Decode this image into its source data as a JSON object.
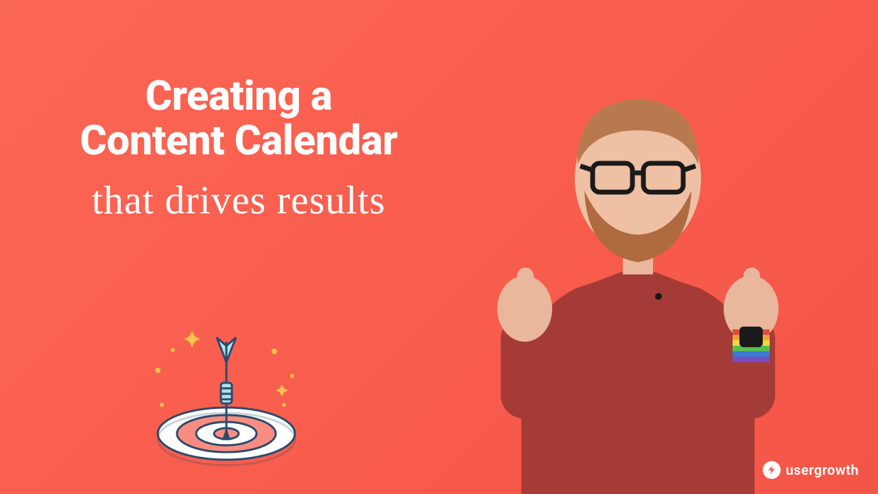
{
  "headline": {
    "line1": "Creating a",
    "line2": "Content Calendar",
    "sub": "that drives results"
  },
  "brand": {
    "text": "usergrowth"
  },
  "icons": {
    "target": "target-dart-icon",
    "brand_badge": "bolt-icon"
  },
  "presenter": {
    "description": "Person with glasses and beard giving two thumbs up, wearing a red t-shirt"
  },
  "colors": {
    "bg_start": "#fb6755",
    "bg_end": "#f35646",
    "text": "#ffffff",
    "target_ring": "#f98c80",
    "target_outline": "#2b4a6b",
    "dart": "#8cd5e3"
  }
}
